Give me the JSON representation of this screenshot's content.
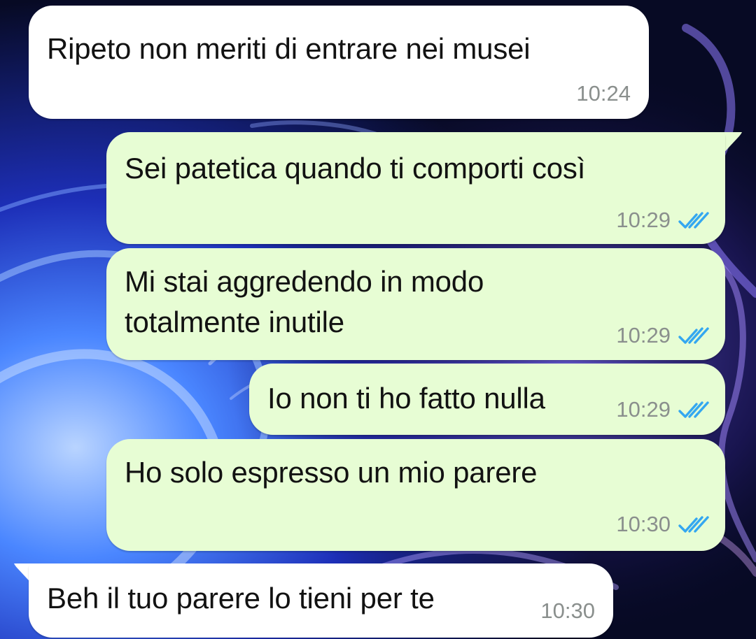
{
  "chat": {
    "messages": [
      {
        "direction": "incoming",
        "text": "Ripeto non meriti di entrare nei musei",
        "time": "10:24"
      },
      {
        "direction": "outgoing",
        "text": "Sei patetica quando ti comporti così",
        "time": "10:29",
        "status_icon": "double-check-read-icon"
      },
      {
        "direction": "outgoing",
        "text_lines": [
          "Mi stai aggredendo in modo",
          "totalmente inutile"
        ],
        "time": "10:29",
        "status_icon": "double-check-read-icon"
      },
      {
        "direction": "outgoing",
        "text": "Io non ti ho fatto nulla",
        "time": "10:29",
        "status_icon": "double-check-read-icon"
      },
      {
        "direction": "outgoing",
        "text": "Ho solo espresso un mio parere",
        "time": "10:30",
        "status_icon": "double-check-read-icon"
      },
      {
        "direction": "incoming",
        "text": "Beh il tuo parere lo tieni per te",
        "time": "10:30"
      }
    ]
  },
  "colors": {
    "incoming_bubble": "#ffffff",
    "outgoing_bubble": "#e7fdd4",
    "read_ticks": "#34a7f0",
    "timestamp": "#8a8f8d"
  }
}
